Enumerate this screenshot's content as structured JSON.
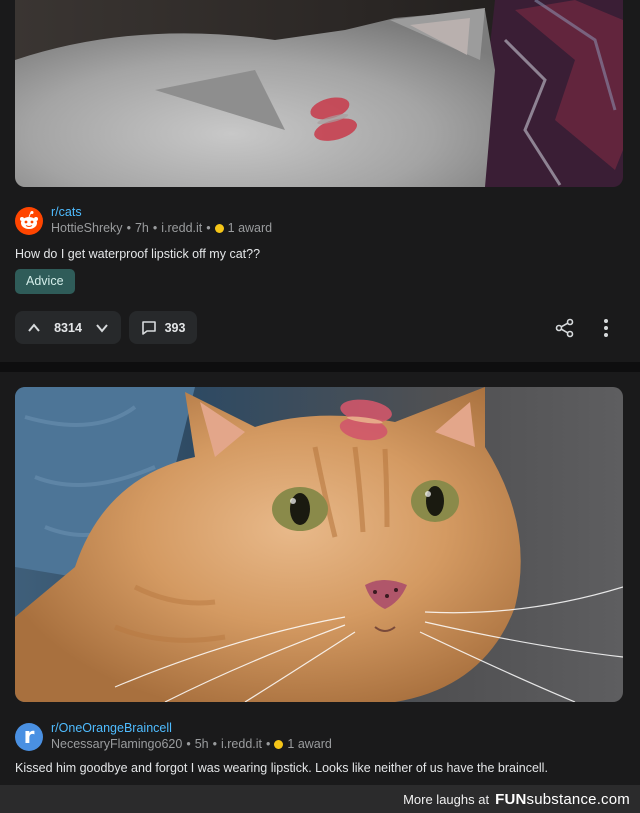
{
  "post1": {
    "subreddit_prefix": "r/",
    "subreddit": "cats",
    "user": "HottieShreky",
    "age": "7h",
    "domain": "i.redd.it",
    "award": "1 award",
    "title": "How do I get waterproof lipstick off my cat??",
    "flair": "Advice",
    "votes": "8314",
    "comments": "393",
    "image_desc_icon": "grey-cat-with-lipstick-kiss-image"
  },
  "post2": {
    "subreddit_prefix": "r/",
    "subreddit": "OneOrangeBraincell",
    "avatar_letter": "r",
    "user": "NecessaryFlamingo620",
    "age": "5h",
    "domain": "i.redd.it",
    "award": "1 award",
    "title": "Kissed him goodbye and forgot I was wearing lipstick. Looks like neither of us have the braincell.",
    "image_desc_icon": "orange-cat-with-lipstick-kiss-image"
  },
  "watermark": {
    "text": "More laughs at",
    "logo_fun": "FUN",
    "logo_rest": "substance.com"
  },
  "colors": {
    "background": "#1a1a1b",
    "link_blue": "#4fbcff",
    "flair_bg": "#2f5c59",
    "award_gold": "#f5c518",
    "snoo_orange": "#ff4500"
  }
}
